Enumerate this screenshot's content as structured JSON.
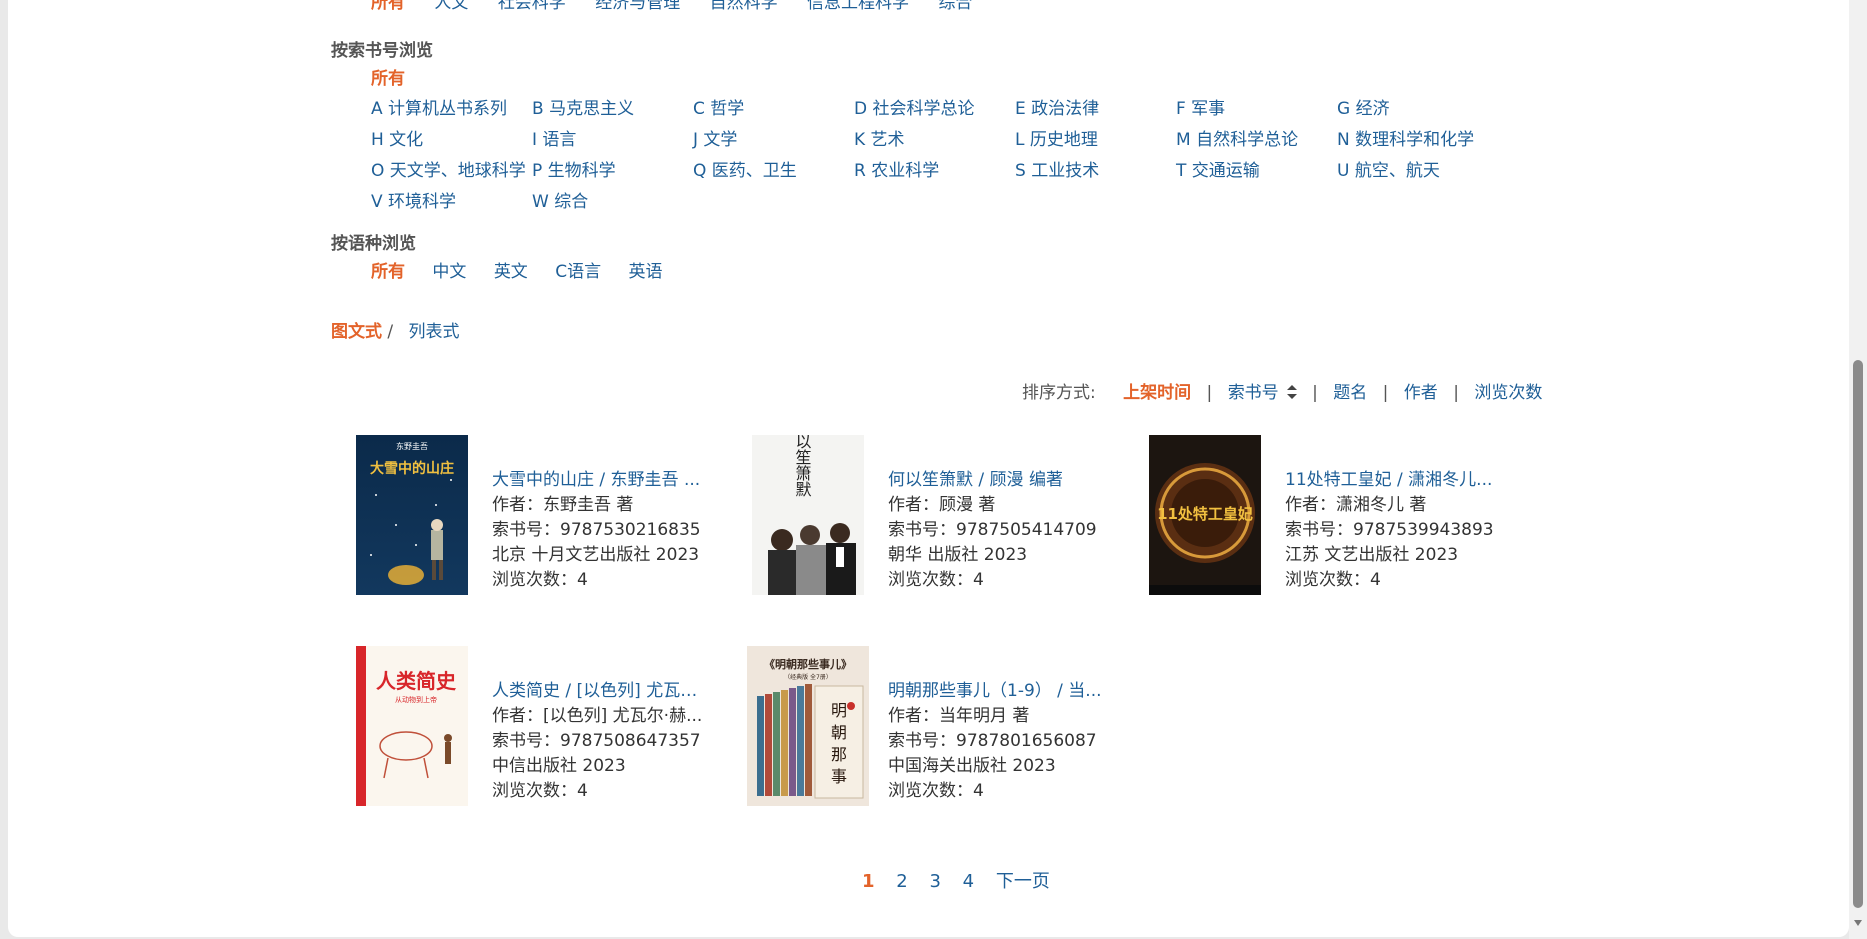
{
  "top_categories": [
    "所有",
    "人文",
    "社会科学",
    "经济与管理",
    "自然科学",
    "信息工程科学",
    "综合"
  ],
  "call_number": {
    "heading": "按索书号浏览",
    "all_label": "所有",
    "items": [
      "A 计算机丛书系列",
      "B 马克思主义",
      "C 哲学",
      "D 社会科学总论",
      "E 政治法律",
      "F 军事",
      "G 经济",
      "H 文化",
      "I 语言",
      "J 文学",
      "K 艺术",
      "L 历史地理",
      "M 自然科学总论",
      "N 数理科学和化学",
      "O 天文学、地球科学",
      "P 生物科学",
      "Q 医药、卫生",
      "R 农业科学",
      "S 工业技术",
      "T 交通运输",
      "U 航空、航天",
      "V 环境科学",
      "W 综合"
    ]
  },
  "language": {
    "heading": "按语种浏览",
    "items": [
      "所有",
      "中文",
      "英文",
      "C语言",
      "英语"
    ]
  },
  "view": {
    "image_label": "图文式",
    "separator": "/",
    "list_label": "列表式"
  },
  "sort": {
    "label": "排序方式:",
    "options": [
      "上架时间",
      "索书号",
      "题名",
      "作者",
      "浏览次数"
    ],
    "separator": "|"
  },
  "books": [
    {
      "title": "大雪中的山庄 / 东野圭吾 ...",
      "author": "作者：东野圭吾 著",
      "isbn": "索书号：9787530216835",
      "publisher": "北京 十月文艺出版社 2023",
      "views": "浏览次数：4",
      "cover_title": "大雪中的山庄",
      "cover_author": "东野圭吾"
    },
    {
      "title": "何以笙箫默 / 顾漫 编著",
      "author": "作者：顾漫 著",
      "isbn": "索书号：9787505414709",
      "publisher": "朝华 出版社 2023",
      "views": "浏览次数：4",
      "cover_title": "何以笙箫默"
    },
    {
      "title": "11处特工皇妃 / 潇湘冬儿...",
      "author": "作者：潇湘冬儿 著",
      "isbn": "索书号：9787539943893",
      "publisher": "江苏 文艺出版社 2023",
      "views": "浏览次数：4",
      "cover_title": "11处特工皇妃"
    },
    {
      "title": "人类简史 / [以色列] 尤瓦尔...",
      "author": "作者：[以色列] 尤瓦尔·赫...",
      "isbn": "索书号：9787508647357",
      "publisher": "中信出版社 2023",
      "views": "浏览次数：4",
      "cover_title": "人类简史",
      "cover_subtitle": "从动物到上帝"
    },
    {
      "title": "明朝那些事儿（1-9） / 当...",
      "author": "作者：当年明月 著",
      "isbn": "索书号：9787801656087",
      "publisher": "中国海关出版社 2023",
      "views": "浏览次数：4",
      "cover_title": "《明朝那些事儿》",
      "cover_subtitle": "（经典版 全7册）"
    }
  ],
  "pagination": [
    "1",
    "2",
    "3",
    "4",
    "下一页"
  ]
}
